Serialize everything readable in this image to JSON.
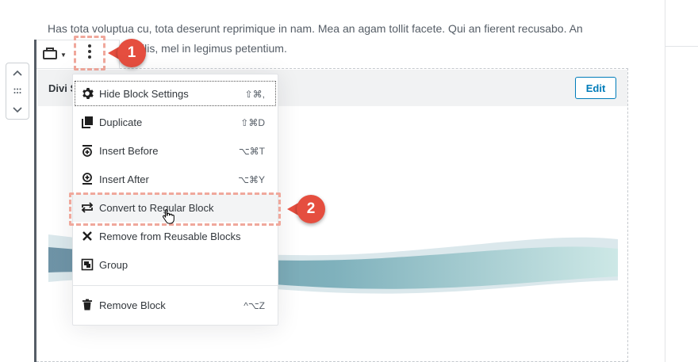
{
  "paragraph": {
    "line1": "Has tota voluptua cu, tota deserunt reprimique in nam. Mea an agam tollit facete. Qui an fierent recusabo. An",
    "line2": "ilis, mel in legimus petentium."
  },
  "block": {
    "title": "Divi S",
    "edit_label": "Edit"
  },
  "toolbar": {
    "reusable_icon": "reusable-block-icon",
    "more_icon": "more-vertical-icon"
  },
  "callouts": {
    "one": "1",
    "two": "2"
  },
  "menu": {
    "items": [
      {
        "label": "Hide Block Settings",
        "shortcut": "⇧⌘,",
        "icon": "gear-icon"
      },
      {
        "label": "Duplicate",
        "shortcut": "⇧⌘D",
        "icon": "duplicate-icon"
      },
      {
        "label": "Insert Before",
        "shortcut": "⌥⌘T",
        "icon": "insert-before-icon"
      },
      {
        "label": "Insert After",
        "shortcut": "⌥⌘Y",
        "icon": "insert-after-icon"
      },
      {
        "label": "Convert to Regular Block",
        "shortcut": "",
        "icon": "convert-icon"
      },
      {
        "label": "Remove from Reusable Blocks",
        "shortcut": "",
        "icon": "close-icon"
      },
      {
        "label": "Group",
        "shortcut": "",
        "icon": "group-icon"
      },
      {
        "label": "Remove Block",
        "shortcut": "^⌥Z",
        "icon": "trash-icon"
      }
    ]
  },
  "colors": {
    "accent": "#007cba",
    "callout": "#e54e3f",
    "highlight_dash": "#f0a89c"
  }
}
